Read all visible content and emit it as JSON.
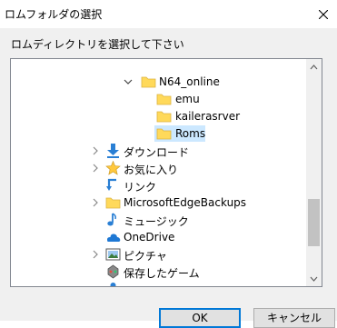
{
  "window": {
    "title": "ロムフォルダの選択",
    "close_glyph": "✕"
  },
  "instruction": "ロムディレクトリを選択して下さい",
  "tree": {
    "items": [
      {
        "label": "N64_online",
        "icon": "folder-icon",
        "expanded": true
      },
      {
        "label": "emu",
        "icon": "folder-icon"
      },
      {
        "label": "kailerasrver",
        "icon": "folder-icon"
      },
      {
        "label": "Roms",
        "icon": "folder-icon",
        "selected": true
      },
      {
        "label": "ダウンロード",
        "icon": "download-arrow-icon"
      },
      {
        "label": "お気に入り",
        "icon": "favorites-star-icon"
      },
      {
        "label": "リンク",
        "icon": "links-arrow-icon"
      },
      {
        "label": "MicrosoftEdgeBackups",
        "icon": "folder-icon"
      },
      {
        "label": "ミュージック",
        "icon": "music-note-icon"
      },
      {
        "label": "OneDrive",
        "icon": "onedrive-cloud-icon"
      },
      {
        "label": "ピクチャ",
        "icon": "pictures-icon"
      },
      {
        "label": "保存したゲーム",
        "icon": "saved-games-icon"
      }
    ]
  },
  "buttons": {
    "ok": "OK",
    "cancel": "キャンセル"
  },
  "colors": {
    "selection": "#cce8ff",
    "folder": "#ffd95a",
    "accent": "#0078d7"
  }
}
